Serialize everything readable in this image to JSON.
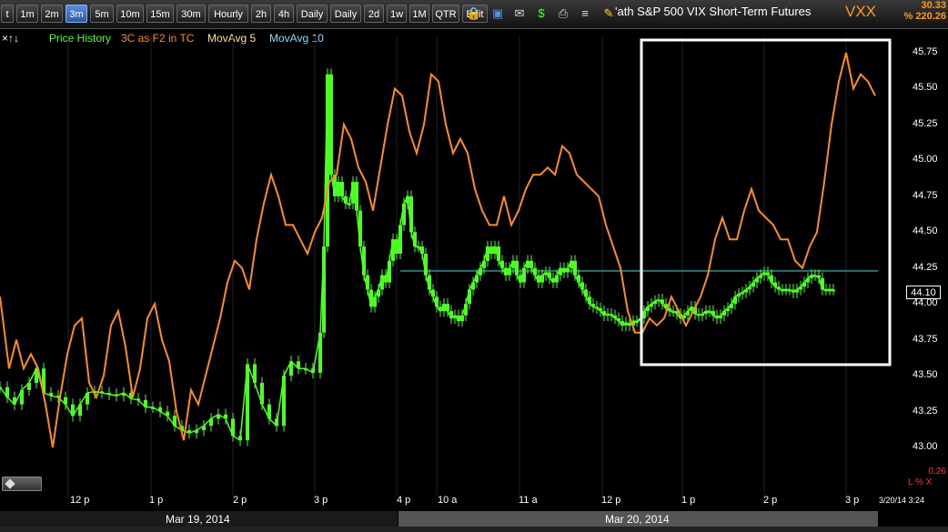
{
  "toolbar": {
    "buttons": [
      {
        "label": "t",
        "active": false
      },
      {
        "label": "1m",
        "active": false
      },
      {
        "label": "2m",
        "active": false
      },
      {
        "label": "3m",
        "active": true
      },
      {
        "label": "5m",
        "active": false
      },
      {
        "label": "10m",
        "active": false
      },
      {
        "label": "15m",
        "active": false
      },
      {
        "label": "30m",
        "active": false
      },
      {
        "label": "Hourly",
        "active": false
      },
      {
        "label": "2h",
        "active": false
      },
      {
        "label": "4h",
        "active": false
      },
      {
        "label": "Daily",
        "active": false
      },
      {
        "label": "Daily",
        "active": false
      },
      {
        "label": "2d",
        "active": false
      },
      {
        "label": "1w",
        "active": false
      },
      {
        "label": "1M",
        "active": false
      },
      {
        "label": "QTR",
        "active": false
      },
      {
        "label": "Edit",
        "active": false
      }
    ],
    "icons": [
      "lock-icon",
      "save-icon",
      "mail-icon",
      "dollar-icon",
      "print-icon",
      "list-icon",
      "pencil-icon"
    ]
  },
  "header": {
    "title": "'ath S&P 500 VIX Short-Term Futures",
    "symbol": "VXX",
    "last_price": "30.33",
    "pct_change": "% 220.26"
  },
  "legend": {
    "arrows": "×↑↓",
    "price_history": "Price History",
    "indicator": "3C as F2 in TC",
    "mavg5": "MovAvg 5",
    "mavg10": "MovAvg 10"
  },
  "colors": {
    "price": "#4cff22",
    "indicator": "#ff8c1a",
    "mavg5": "#ffe680",
    "mavg10": "#7fdfff",
    "highlight_box": "#ffffff",
    "hline": "#2f6f6f"
  },
  "current_price_label": "44.10",
  "lower_panel": {
    "value": "0.26",
    "toggles": "L % X"
  },
  "timestamp": "3/20/14 3:24",
  "dates": [
    "Mar 19, 2014",
    "Mar 20, 2014"
  ],
  "chart_data": {
    "type": "line",
    "title": "",
    "ylim": [
      42.9,
      45.85
    ],
    "y_ticks": [
      "45.75",
      "45.50",
      "45.25",
      "45.00",
      "44.75",
      "44.50",
      "44.25",
      "44.00",
      "43.75",
      "43.50",
      "43.25",
      "43.00"
    ],
    "x_ticks": [
      "12 p",
      "1 p",
      "2 p",
      "3 p",
      "4 p",
      "10 a",
      "11 a",
      "12 p",
      "1 p",
      "2 p",
      "3 p"
    ],
    "reference_line": 44.23,
    "highlight_window": [
      "Mar 20 12:20",
      "Mar 20 3:24"
    ],
    "price_series": {
      "name": "Price History",
      "x": [
        0,
        8,
        16,
        24,
        32,
        40,
        48,
        56,
        64,
        72,
        80,
        88,
        96,
        104,
        112,
        120,
        128,
        136,
        144,
        152,
        160,
        168,
        176,
        184,
        192,
        200,
        208,
        216,
        224,
        232,
        240,
        248,
        256,
        264,
        272,
        280,
        288,
        296,
        304,
        312,
        320,
        328,
        336,
        344,
        352,
        356,
        360,
        364,
        368,
        372,
        376,
        380,
        384,
        388,
        392,
        396,
        400,
        404,
        408,
        412,
        416,
        420,
        424,
        428,
        432,
        436,
        440,
        444,
        448,
        452,
        456,
        460,
        464,
        468,
        472,
        476,
        480,
        484,
        488,
        492,
        496,
        500,
        504,
        508,
        512,
        516,
        520,
        524,
        528,
        532,
        536,
        540,
        544,
        548,
        552,
        556,
        560,
        564,
        568,
        572,
        576,
        580,
        584,
        588,
        592,
        596,
        600,
        604,
        608,
        612,
        616,
        620,
        624,
        628,
        632,
        636,
        640,
        644,
        648,
        652,
        656,
        660,
        664,
        668,
        672,
        676,
        680,
        684,
        688,
        692,
        696,
        700,
        704,
        708,
        712,
        716,
        720,
        724,
        728,
        732,
        736,
        740,
        744,
        748,
        752,
        756,
        760,
        764,
        768,
        772,
        776,
        780,
        784,
        788,
        792,
        796,
        800,
        804,
        808,
        812,
        816,
        820,
        824,
        828,
        832,
        836,
        840,
        844,
        848,
        852,
        856,
        860,
        864,
        868,
        872,
        876,
        880,
        884,
        888,
        892,
        896,
        900,
        904,
        908,
        912,
        916,
        920,
        924,
        928,
        932,
        936,
        940,
        944,
        948,
        952,
        956,
        960,
        964
      ],
      "values": [
        43.42,
        43.35,
        43.3,
        43.4,
        43.45,
        43.55,
        43.38,
        43.36,
        43.35,
        43.3,
        43.22,
        43.3,
        43.38,
        43.39,
        43.38,
        43.37,
        43.36,
        43.38,
        43.34,
        43.33,
        43.28,
        43.28,
        43.25,
        43.22,
        43.15,
        43.12,
        43.1,
        43.12,
        43.15,
        43.2,
        43.23,
        43.2,
        43.08,
        43.05,
        43.58,
        43.45,
        43.3,
        43.2,
        43.15,
        43.5,
        43.6,
        43.55,
        43.55,
        43.52,
        43.8,
        44.4,
        45.6,
        44.9,
        44.75,
        44.85,
        44.75,
        44.7,
        44.7,
        44.85,
        44.65,
        44.4,
        44.2,
        44.1,
        43.98,
        44.05,
        44.1,
        44.2,
        44.15,
        44.3,
        44.45,
        44.35,
        44.55,
        44.7,
        44.75,
        44.5,
        44.4,
        44.4,
        44.35,
        44.2,
        44.1,
        44.05,
        43.98,
        43.95,
        44.0,
        43.95,
        43.9,
        43.92,
        43.88,
        43.92,
        44.0,
        44.1,
        44.15,
        44.2,
        44.25,
        44.3,
        44.4,
        44.35,
        44.4,
        44.3,
        44.25,
        44.2,
        44.25,
        44.3,
        44.2,
        44.15,
        44.25,
        44.3,
        44.25,
        44.2,
        44.15,
        44.2,
        44.22,
        44.18,
        44.15,
        44.2,
        44.25,
        44.22,
        44.25,
        44.3,
        44.2,
        44.15,
        44.1,
        44.05,
        44.0,
        43.98,
        43.97,
        43.95,
        43.92,
        43.93,
        43.92,
        43.9,
        43.88,
        43.85,
        43.87,
        43.85,
        43.88,
        43.88,
        43.9,
        43.95,
        43.98,
        44.0,
        44.02,
        44.03,
        44.0,
        43.97,
        43.95,
        43.95,
        43.93,
        43.9,
        43.92,
        43.95,
        43.98,
        43.93,
        43.92,
        43.93,
        43.95,
        43.95,
        43.92,
        43.9,
        43.92,
        43.95,
        43.97,
        44.0,
        44.05,
        44.07,
        44.08,
        44.1,
        44.12,
        44.15,
        44.18,
        44.2,
        44.22,
        44.2,
        44.15,
        44.12,
        44.1,
        44.1,
        44.1,
        44.1,
        44.08,
        44.1,
        44.12,
        44.15,
        44.18,
        44.2,
        44.2,
        44.18,
        44.1,
        44.1,
        44.1,
        44.1
      ]
    },
    "indicator_series": {
      "name": "3C as F2 in TC",
      "x": [
        0,
        10,
        18,
        26,
        34,
        42,
        50,
        58,
        66,
        74,
        82,
        90,
        98,
        106,
        114,
        122,
        130,
        138,
        146,
        154,
        162,
        170,
        178,
        186,
        194,
        202,
        210,
        218,
        226,
        234,
        242,
        250,
        258,
        266,
        274,
        282,
        290,
        298,
        306,
        314,
        322,
        330,
        338,
        346,
        354,
        362,
        370,
        378,
        386,
        394,
        402,
        410,
        418,
        426,
        434,
        442,
        450,
        458,
        466,
        474,
        482,
        490,
        498,
        506,
        514,
        522,
        530,
        538,
        546,
        554,
        562,
        570,
        578,
        586,
        594,
        602,
        610,
        618,
        626,
        634,
        642,
        650,
        658,
        666,
        674,
        682,
        690,
        698,
        706,
        714,
        722,
        730,
        738,
        746,
        754,
        762,
        770,
        778,
        786,
        794,
        802,
        810,
        818,
        826,
        834,
        842,
        850,
        858,
        866,
        874,
        882,
        890,
        898,
        906,
        914,
        922,
        930,
        938,
        946,
        954,
        962
      ],
      "values": [
        44.05,
        43.55,
        43.75,
        43.55,
        43.65,
        43.55,
        43.3,
        43.0,
        43.35,
        43.65,
        43.85,
        43.9,
        43.45,
        43.35,
        43.5,
        43.85,
        43.95,
        43.7,
        43.35,
        43.55,
        43.9,
        44.0,
        43.75,
        43.6,
        43.25,
        43.05,
        43.4,
        43.3,
        43.5,
        43.7,
        43.9,
        44.15,
        44.3,
        44.25,
        44.1,
        44.45,
        44.7,
        44.9,
        44.75,
        44.55,
        44.55,
        44.45,
        44.35,
        44.5,
        44.6,
        44.85,
        44.9,
        45.25,
        45.15,
        44.95,
        44.85,
        44.65,
        44.95,
        45.25,
        45.5,
        45.45,
        45.2,
        45.05,
        45.25,
        45.6,
        45.55,
        45.25,
        45.05,
        45.15,
        45.05,
        44.8,
        44.65,
        44.55,
        44.55,
        44.75,
        44.55,
        44.65,
        44.8,
        44.9,
        44.9,
        44.95,
        44.9,
        45.1,
        45.05,
        44.9,
        44.85,
        44.8,
        44.75,
        44.55,
        44.4,
        44.25,
        43.95,
        43.8,
        43.8,
        43.9,
        43.85,
        43.9,
        44.05,
        43.95,
        43.85,
        43.95,
        44.05,
        44.2,
        44.45,
        44.6,
        44.45,
        44.45,
        44.65,
        44.8,
        44.65,
        44.6,
        44.55,
        44.45,
        44.45,
        44.3,
        44.25,
        44.4,
        44.5,
        44.85,
        45.25,
        45.55,
        45.75,
        45.5,
        45.6,
        45.55,
        45.45
      ]
    }
  }
}
